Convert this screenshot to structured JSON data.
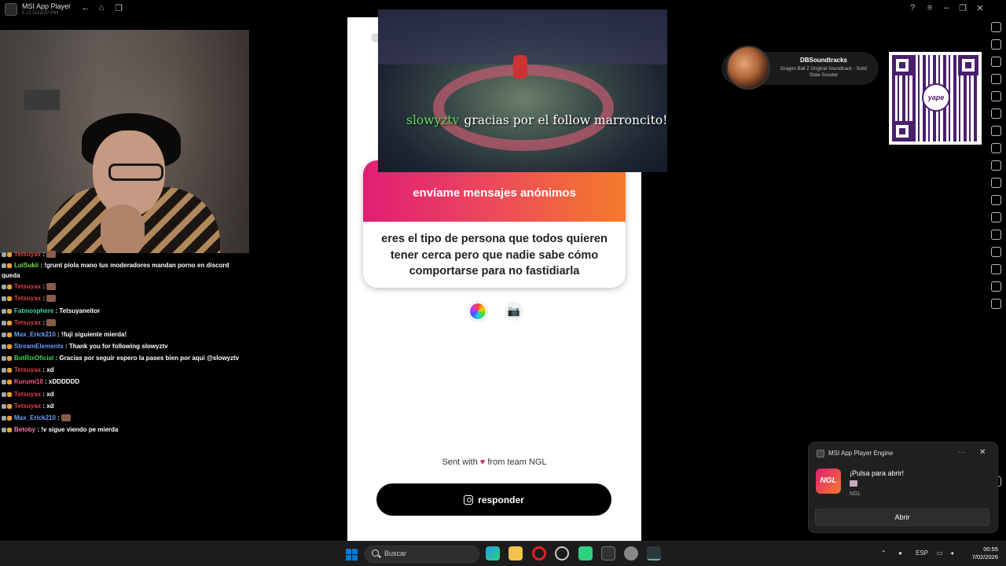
{
  "window": {
    "title": "MSI App Player",
    "subtitle": "5.22 Dolar32 P64"
  },
  "chat": [
    {
      "user": "Tetsuyax",
      "color": "#e04040",
      "message": ":",
      "emote": true
    },
    {
      "user": "LuiSukii",
      "color": "#7ee05a",
      "message": ": !grunt piola mano tus moderadores mandan porno en discord",
      "cont": "queda"
    },
    {
      "user": "Tetsuyax",
      "color": "#e04040",
      "message": ":",
      "emote": true
    },
    {
      "user": "Tetsuyax",
      "color": "#e04040",
      "message": ":",
      "emote": true
    },
    {
      "user": "Fatmosphere",
      "color": "#3ad6a8",
      "message": ": Tetsuyaneitor"
    },
    {
      "user": "Tetsuyax",
      "color": "#e04040",
      "message": ":",
      "emote": true
    },
    {
      "user": "Max_Erick210",
      "color": "#6aa0ff",
      "message": ": !fuji siguiente mierda!"
    },
    {
      "user": "StreamElements",
      "color": "#6a9fff",
      "message": ": Thank you for following slowyztv"
    },
    {
      "user": "BotRixOficial",
      "color": "#3ad64a",
      "message": ": Gracias por seguir espero la pases bien por aqui @slowyztv"
    },
    {
      "user": "Tetsuyax",
      "color": "#e04040",
      "message": ": xd"
    },
    {
      "user": "Kurumi10",
      "color": "#ff5a9a",
      "message": ": xDDDDDD"
    },
    {
      "user": "Tetsuyax",
      "color": "#e04040",
      "message": ": xd"
    },
    {
      "user": "Tetsuyax",
      "color": "#e04040",
      "message": ": xd"
    },
    {
      "user": "Max_Erick210",
      "color": "#6aa0ff",
      "message": ":",
      "emote": true
    },
    {
      "user": "Betoby",
      "color": "#ff7aa8",
      "message": ": !v sigue viendo pe mierda"
    }
  ],
  "game": {
    "username": "slowyztv",
    "message": "gracias por el follow marroncito!"
  },
  "ngl": {
    "card_title": "envíame mensajes anónimos",
    "message": "eres el tipo de persona que todos quieren tener cerca pero que nadie sabe cómo comportarse para no fastidiarla",
    "sent_prefix": "Sent with",
    "sent_suffix": "from team NGL",
    "reply_button": "responder",
    "camera_icon": "📷"
  },
  "now_playing": {
    "artist": "DBSoundtracks",
    "track": "Dragon Ball Z Original Soundtrack - Solid State Scouter"
  },
  "qr": {
    "brand": "yape",
    "color": "#4a1f6e"
  },
  "notification": {
    "app": "MSI App Player Engine",
    "text": "¡Pulsa para abrir!",
    "source": "NGL",
    "icon_text": "NGL",
    "button": "Abrir",
    "more": "···",
    "close": "✕"
  },
  "taskbar": {
    "search_placeholder": "Buscar",
    "language": "ESP",
    "time": "00:55",
    "date": "7/02/2026"
  }
}
